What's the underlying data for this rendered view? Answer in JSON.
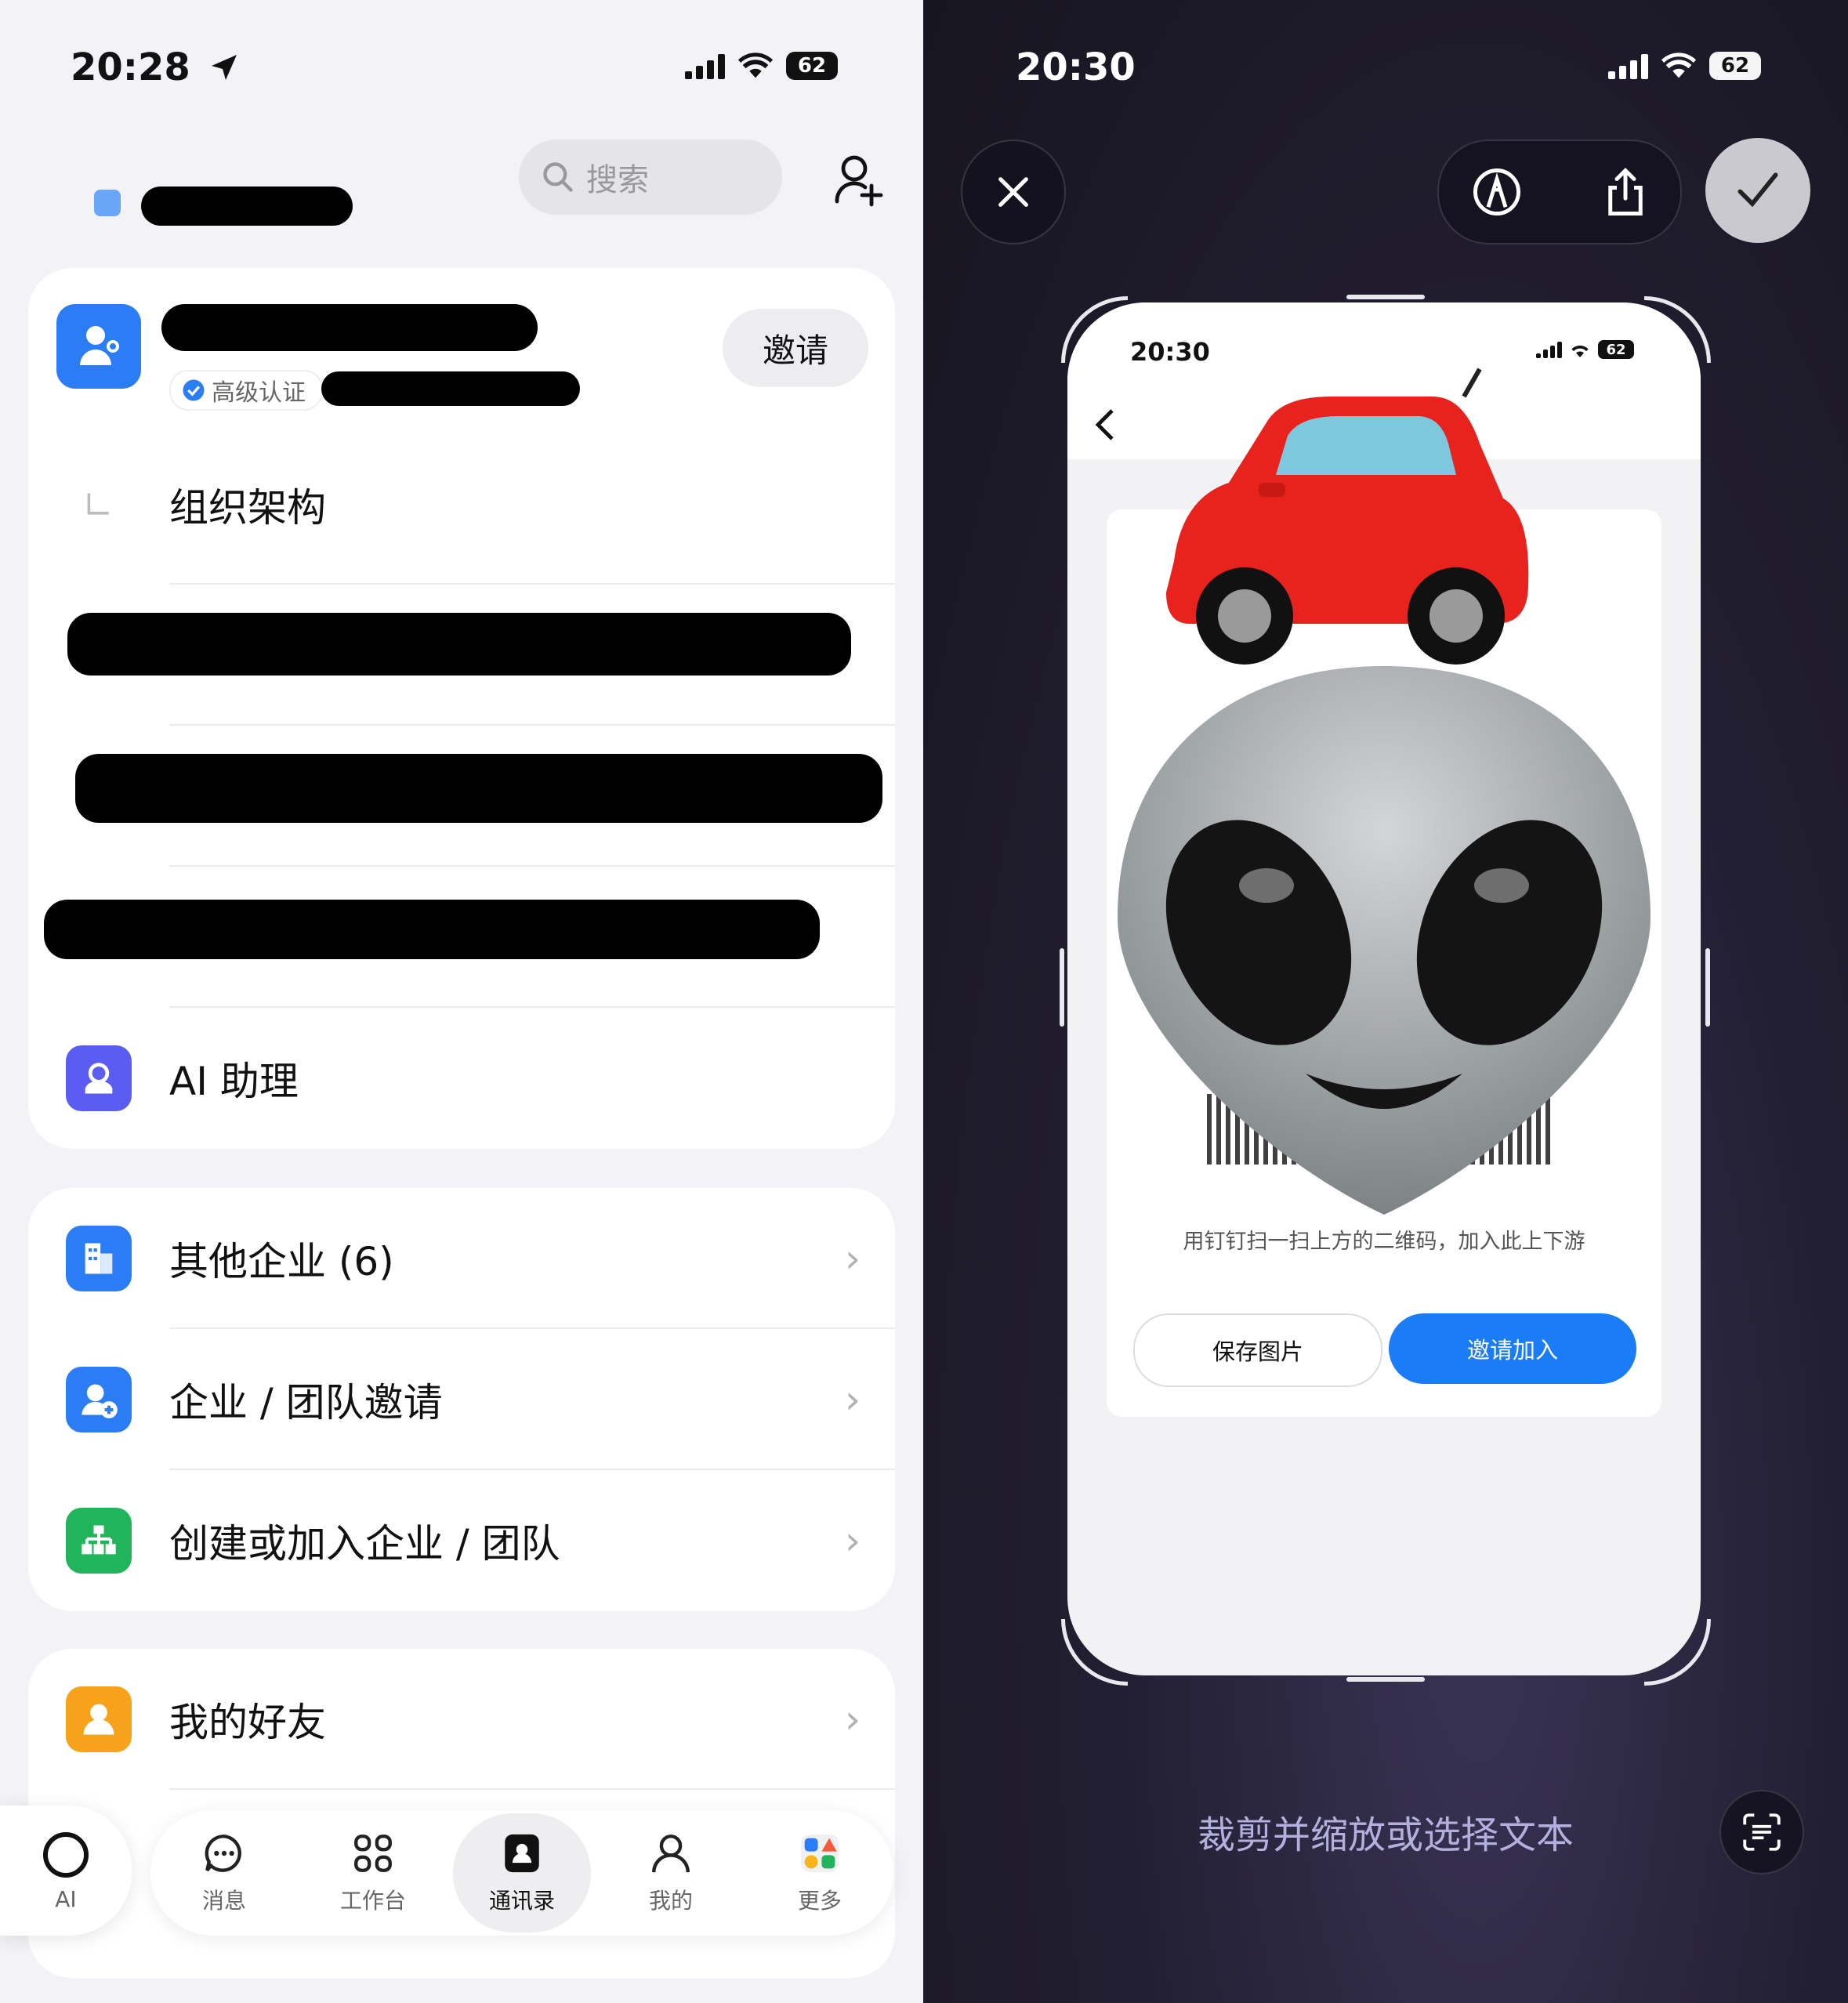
{
  "left": {
    "status": {
      "time": "20:28",
      "battery": "62"
    },
    "header": {
      "search_placeholder": "搜索"
    },
    "org_card": {
      "invite_label": "邀请",
      "badge_label": "高级认证",
      "org_structure_label": "组织架构",
      "ai_assistant_label": "AI 助理"
    },
    "menu": [
      {
        "label": "其他企业 (6)",
        "icon": "building-icon",
        "color": "#2b7df6"
      },
      {
        "label": "企业 / 团队邀请",
        "icon": "user-add-icon",
        "color": "#2b7df6"
      },
      {
        "label": "创建或加入企业 / 团队",
        "icon": "org-chart-icon",
        "color": "#21b45a"
      }
    ],
    "friends": {
      "label": "我的好友",
      "icon": "person-icon",
      "color": "#f7a21b"
    },
    "tabbar": {
      "ai": "AI",
      "items": [
        {
          "label": "消息",
          "icon": "chat-icon"
        },
        {
          "label": "工作台",
          "icon": "grid-icon"
        },
        {
          "label": "通讯录",
          "icon": "contacts-icon",
          "active": true
        },
        {
          "label": "我的",
          "icon": "person-icon"
        },
        {
          "label": "更多",
          "icon": "apps-icon"
        }
      ]
    }
  },
  "right": {
    "status": {
      "time": "20:30",
      "battery": "62"
    },
    "preview": {
      "time": "20:30",
      "battery": "62",
      "caption": "用钉钉扫一扫上方的二维码，加入此上下游",
      "save_button": "保存图片",
      "invite_button": "邀请加入"
    },
    "hint": "裁剪并缩放或选择文本",
    "accent": "#1a7cf7"
  }
}
